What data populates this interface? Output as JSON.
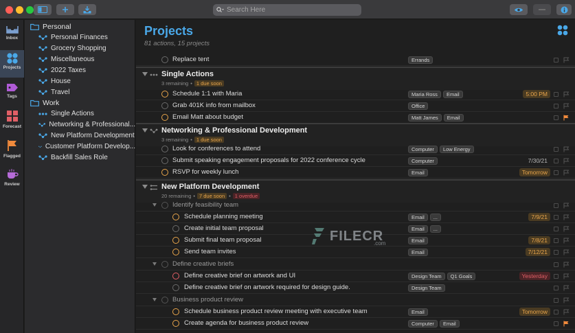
{
  "window": {
    "search_placeholder": "Search Here"
  },
  "rail": [
    {
      "label": "Inbox",
      "icon": "inbox-icon",
      "color": "#7b9fcf"
    },
    {
      "label": "Projects",
      "icon": "projects-icon",
      "color": "#4aa8e8",
      "active": true
    },
    {
      "label": "Tags",
      "icon": "tags-icon",
      "color": "#b05bd6"
    },
    {
      "label": "Forecast",
      "icon": "forecast-icon",
      "color": "#e15f66"
    },
    {
      "label": "Flagged",
      "icon": "flag-icon",
      "color": "#f08a3c"
    },
    {
      "label": "Review",
      "icon": "review-icon",
      "color": "#b66bd8"
    }
  ],
  "sidebar": {
    "folders": [
      {
        "label": "Personal",
        "items": [
          "Personal Finances",
          "Grocery Shopping",
          "Miscellaneous",
          "2022 Taxes",
          "House",
          "Travel"
        ]
      },
      {
        "label": "Work",
        "items": [
          "Single Actions",
          "Networking & Professional...",
          "New Platform Development",
          "Customer Platform Develop...",
          "Backfill Sales Role"
        ]
      }
    ]
  },
  "main": {
    "title": "Projects",
    "subtitle": "81 actions, 15 projects",
    "top_row": {
      "title": "Replace tent",
      "tags": [
        "Errands"
      ]
    },
    "sections": [
      {
        "title": "Single Actions",
        "meta": "3 remaining",
        "soon": "1 due soon",
        "rows": [
          {
            "title": "Schedule 1:1 with Maria",
            "circle": "orange",
            "tags": [
              "Maria Ross",
              "Email"
            ],
            "due": "5:00 PM",
            "due_style": "soon"
          },
          {
            "title": "Grab 401K info from mailbox",
            "circle": "gray",
            "tags": [
              "Office"
            ]
          },
          {
            "title": "Email Matt about budget",
            "circle": "orange",
            "tags": [
              "Matt James",
              "Email"
            ],
            "flagged": true
          }
        ]
      },
      {
        "title": "Networking & Professional Development",
        "meta": "3 remaining",
        "soon": "1 due soon",
        "rows": [
          {
            "title": "Look for conferences to attend",
            "circle": "gray",
            "tags": [
              "Computer",
              "Low Energy"
            ]
          },
          {
            "title": "Submit speaking engagement proposals for 2022 conference cycle",
            "circle": "gray",
            "tags": [
              "Computer"
            ],
            "due": "7/30/21"
          },
          {
            "title": "RSVP for weekly lunch",
            "circle": "orange",
            "tags": [
              "Email"
            ],
            "due": "Tomorrow",
            "due_style": "soon"
          }
        ]
      },
      {
        "title": "New Platform Development",
        "meta": "20 remaining",
        "soon": "7 due soon",
        "overdue": "1 overdue",
        "groups": [
          {
            "title": "Identify feasibility team",
            "rows": [
              {
                "title": "Schedule planning meeting",
                "circle": "orange",
                "tags": [
                  "Email",
                  "..."
                ],
                "due": "7/9/21",
                "due_style": "soon"
              },
              {
                "title": "Create initial team proposal",
                "circle": "gray",
                "tags": [
                  "Email",
                  "..."
                ]
              },
              {
                "title": "Submit final team proposal",
                "circle": "orange",
                "tags": [
                  "Email"
                ],
                "due": "7/8/21",
                "due_style": "soon"
              },
              {
                "title": "Send team invites",
                "circle": "orange",
                "tags": [
                  "Email"
                ],
                "due": "7/12/21",
                "due_style": "soon"
              }
            ]
          },
          {
            "title": "Define creative briefs",
            "rows": [
              {
                "title": "Define creative brief on artwork and UI",
                "circle": "red",
                "tags": [
                  "Design Team",
                  "Q1 Goals"
                ],
                "due": "Yesterday",
                "due_style": "overdue"
              },
              {
                "title": "Define creative brief on artwork required for design guide.",
                "circle": "gray",
                "tags": [
                  "Design Team"
                ]
              }
            ]
          },
          {
            "title": "Business product review",
            "rows": [
              {
                "title": "Schedule business product review meeting with executive team",
                "circle": "orange",
                "tags": [
                  "Email"
                ],
                "due": "Tomorrow",
                "due_style": "soon"
              },
              {
                "title": "Create agenda for business product review",
                "circle": "orange",
                "tags": [
                  "Computer",
                  "Email"
                ],
                "flagged": true
              }
            ]
          }
        ]
      }
    ]
  },
  "watermark": {
    "text": "FILECR",
    "domain": ".com"
  },
  "colors": {
    "accent": "#4aa8e8",
    "soon": "#e7a44b",
    "overdue": "#e15f66",
    "flag": "#f08a3c"
  }
}
